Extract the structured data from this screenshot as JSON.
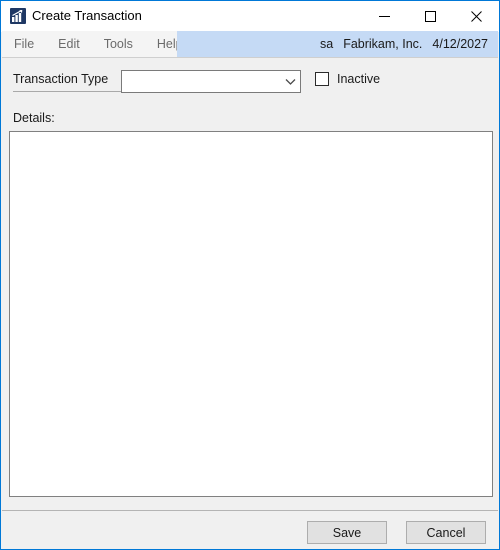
{
  "window": {
    "title": "Create Transaction",
    "icon": "bar-chart-icon",
    "accent_color": "#0078d7",
    "controls": {
      "minimize": "Minimize",
      "maximize": "Maximize",
      "close": "Close"
    }
  },
  "menu": {
    "items": [
      {
        "label": "File"
      },
      {
        "label": "Edit"
      },
      {
        "label": "Tools"
      },
      {
        "label": "Help"
      }
    ],
    "status": {
      "user": "sa",
      "company": "Fabrikam, Inc.",
      "date": "4/12/2027",
      "background_color": "#c5daf5"
    }
  },
  "form": {
    "transaction_type": {
      "label": "Transaction Type",
      "value": "",
      "placeholder": ""
    },
    "inactive": {
      "label": "Inactive",
      "checked": false
    },
    "details": {
      "label": "Details:",
      "value": "",
      "placeholder": ""
    }
  },
  "footer": {
    "save_label": "Save",
    "cancel_label": "Cancel"
  }
}
